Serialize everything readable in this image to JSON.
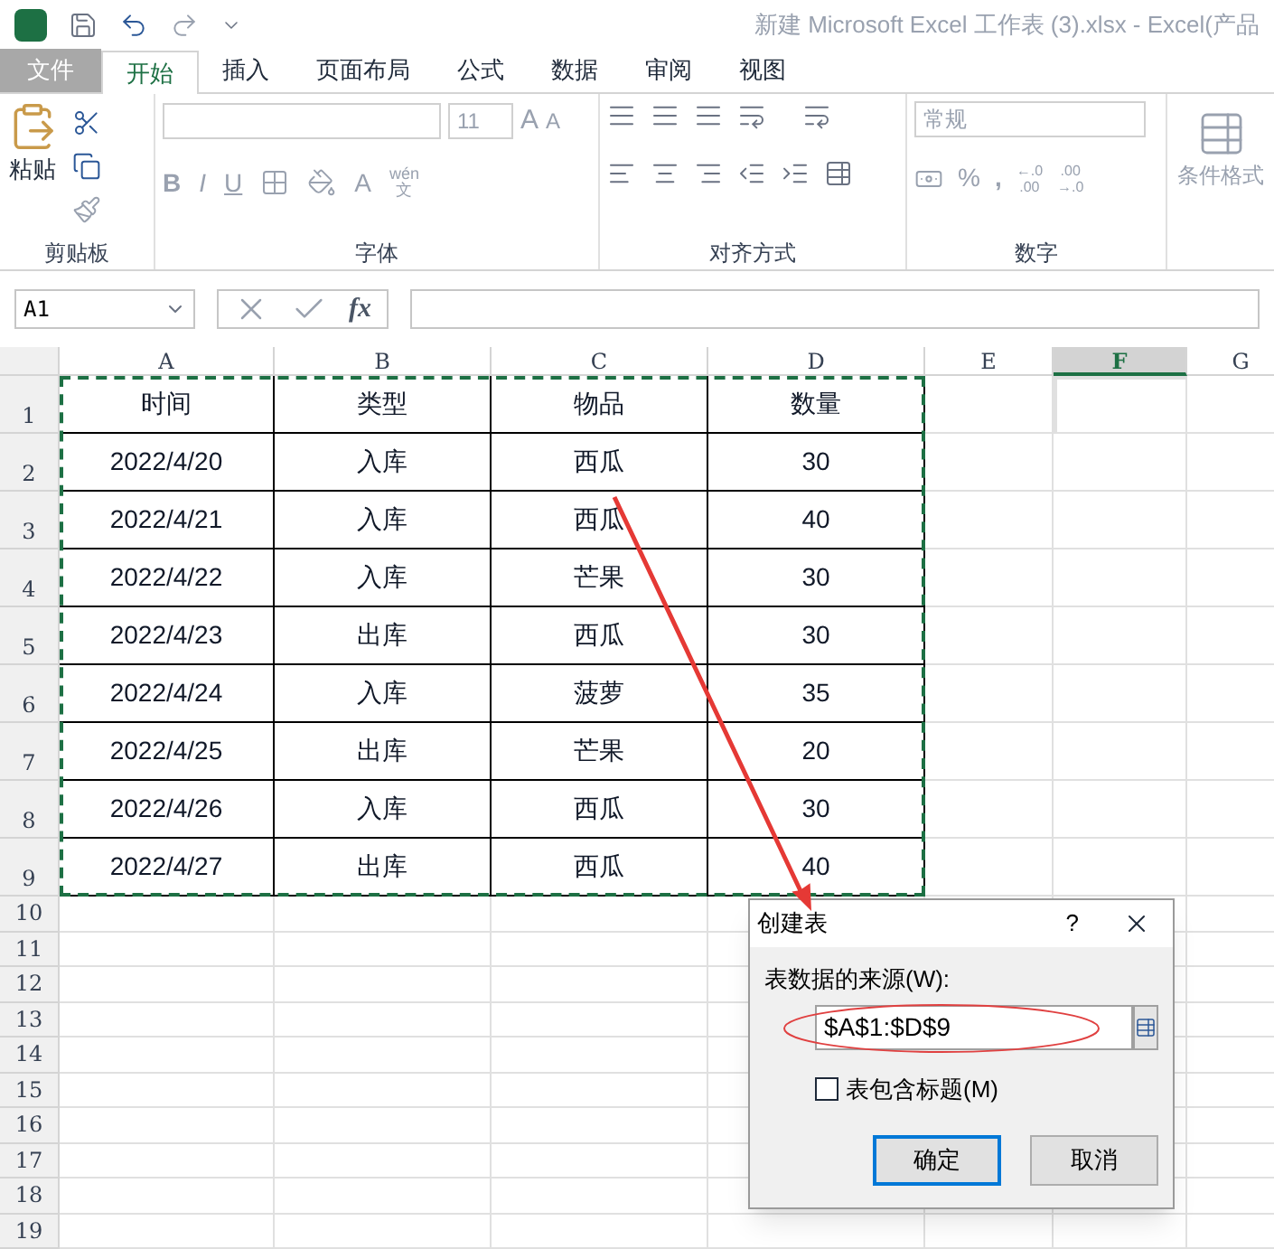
{
  "title_bar": {
    "title": "新建 Microsoft Excel 工作表 (3).xlsx - Excel(产品"
  },
  "tabs": [
    {
      "label": "文件",
      "kind": "file",
      "selected": false
    },
    {
      "label": "开始",
      "kind": "tab",
      "selected": true
    },
    {
      "label": "插入",
      "kind": "tab",
      "selected": false
    },
    {
      "label": "页面布局",
      "kind": "tab",
      "selected": false
    },
    {
      "label": "公式",
      "kind": "tab",
      "selected": false
    },
    {
      "label": "数据",
      "kind": "tab",
      "selected": false
    },
    {
      "label": "审阅",
      "kind": "tab",
      "selected": false
    },
    {
      "label": "视图",
      "kind": "tab",
      "selected": false
    }
  ],
  "ribbon": {
    "paste_label": "粘贴",
    "font_size": "11",
    "grow_font": "A",
    "shrink_font": "A",
    "format_buttons": [
      "B",
      "I",
      "U"
    ],
    "font_color_button": "A",
    "phonetic": [
      "wén",
      "文"
    ],
    "number_format": "常规",
    "percent": "%",
    "comma": ",",
    "decimal_increase": [
      "←.0",
      ".00"
    ],
    "decimal_decrease": [
      ".00",
      "→.0"
    ],
    "conditional_format": "条件格式",
    "groups": [
      "剪贴板",
      "字体",
      "对齐方式",
      "数字"
    ]
  },
  "formula_bar": {
    "name_box": "A1",
    "fx": "fx"
  },
  "columns": [
    {
      "label": "A",
      "selected": false
    },
    {
      "label": "B",
      "selected": false
    },
    {
      "label": "C",
      "selected": false
    },
    {
      "label": "D",
      "selected": false
    },
    {
      "label": "E",
      "selected": false
    },
    {
      "label": "F",
      "selected": true
    },
    {
      "label": "G",
      "selected": false
    }
  ],
  "rows": [
    {
      "header": "1",
      "cells": [
        "时间",
        "类型",
        "物品",
        "数量"
      ]
    },
    {
      "header": "2",
      "cells": [
        "2022/4/20",
        "入库",
        "西瓜",
        "30"
      ]
    },
    {
      "header": "3",
      "cells": [
        "2022/4/21",
        "入库",
        "西瓜",
        "40"
      ]
    },
    {
      "header": "4",
      "cells": [
        "2022/4/22",
        "入库",
        "芒果",
        "30"
      ]
    },
    {
      "header": "5",
      "cells": [
        "2022/4/23",
        "出库",
        "西瓜",
        "30"
      ]
    },
    {
      "header": "6",
      "cells": [
        "2022/4/24",
        "入库",
        "菠萝",
        "35"
      ]
    },
    {
      "header": "7",
      "cells": [
        "2022/4/25",
        "出库",
        "芒果",
        "20"
      ]
    },
    {
      "header": "8",
      "cells": [
        "2022/4/26",
        "入库",
        "西瓜",
        "30"
      ]
    },
    {
      "header": "9",
      "cells": [
        "2022/4/27",
        "出库",
        "西瓜",
        "40"
      ]
    },
    {
      "header": "10",
      "cells": []
    },
    {
      "header": "11",
      "cells": []
    },
    {
      "header": "12",
      "cells": []
    },
    {
      "header": "13",
      "cells": []
    },
    {
      "header": "14",
      "cells": []
    },
    {
      "header": "15",
      "cells": []
    },
    {
      "header": "16",
      "cells": []
    },
    {
      "header": "17",
      "cells": []
    },
    {
      "header": "18",
      "cells": []
    },
    {
      "header": "19",
      "cells": []
    }
  ],
  "dialog": {
    "title": "创建表",
    "help": "?",
    "source_label": "表数据的来源(W):",
    "source_value": "$A$1:$D$9",
    "checkbox": {
      "label": "表包含标题(M)",
      "checked": false
    },
    "buttons": [
      {
        "label": "确定",
        "selected": true
      },
      {
        "label": "取消",
        "selected": false
      }
    ]
  }
}
